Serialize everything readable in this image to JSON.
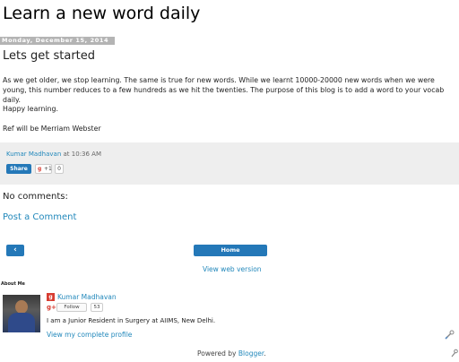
{
  "blog": {
    "title": "Learn a new word daily"
  },
  "post": {
    "date": "Monday, December 15, 2014",
    "title": "Lets get started",
    "paragraphs": [
      "As we get older, we stop learning. The same is true for new words. While we learnt 10000-20000 new words when we were young, this number reduces to a few hundreds as we hit the twenties. The purpose of this blog is to add a word to your vocab daily.",
      "Happy learning.",
      "Ref will be Merriam Webster"
    ],
    "footer": {
      "author": "Kumar Madhavan",
      "at": "at",
      "time": "10:36 AM",
      "share_label": "Share",
      "gplus_label": "+1",
      "gplus_count": "0"
    }
  },
  "comments": {
    "heading": "No comments:",
    "post_link": "Post a Comment"
  },
  "pager": {
    "older_label": "‹",
    "home_label": "Home",
    "view_web": "View web version"
  },
  "about": {
    "heading": "About Me",
    "name": "Kumar Madhavan",
    "follow_label": "Follow",
    "follow_count": "53",
    "description": "I am a Junior Resident in Surgery at AIIMS, New Delhi.",
    "profile_link": "View my complete profile"
  },
  "footer": {
    "powered_prefix": "Powered by",
    "powered_link": "Blogger",
    "powered_suffix": "."
  },
  "colors": {
    "link": "#2288bb",
    "button": "#2478b8",
    "footer_bg": "#eeeeee",
    "date_bg": "#b4b4b4",
    "gplus": "#d73d32"
  },
  "icons": [
    "google-plus-icon",
    "chevron-left-icon",
    "blogger-profile-icon",
    "edit-wrench-icon"
  ]
}
